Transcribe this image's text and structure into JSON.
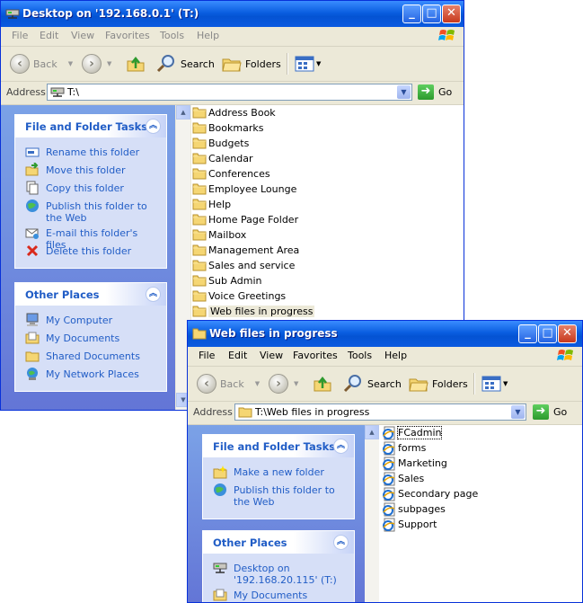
{
  "back_window": {
    "title": "Desktop on '192.168.0.1' (T:)",
    "menu": [
      "File",
      "Edit",
      "View",
      "Favorites",
      "Tools",
      "Help"
    ],
    "toolbar": {
      "back": "Back",
      "search": "Search",
      "folders": "Folders"
    },
    "address": {
      "label": "Address",
      "value": "T:\\",
      "go": "Go"
    },
    "file_tasks": {
      "title": "File and Folder Tasks",
      "items": [
        {
          "label": "Rename this folder",
          "icon": "rename-icon"
        },
        {
          "label": "Move this folder",
          "icon": "move-icon"
        },
        {
          "label": "Copy this folder",
          "icon": "copy-icon"
        },
        {
          "label": "Publish this folder to the Web",
          "icon": "publish-icon"
        },
        {
          "label": "E-mail this folder's files",
          "icon": "email-icon"
        },
        {
          "label": "Delete this folder",
          "icon": "delete-icon"
        }
      ]
    },
    "other_places": {
      "title": "Other Places",
      "items": [
        {
          "label": "My Computer",
          "icon": "computer-icon"
        },
        {
          "label": "My Documents",
          "icon": "documents-icon"
        },
        {
          "label": "Shared Documents",
          "icon": "shared-folder-icon"
        },
        {
          "label": "My Network Places",
          "icon": "network-icon"
        }
      ]
    },
    "folders": [
      "Address Book",
      "Bookmarks",
      "Budgets",
      "Calendar",
      "Conferences",
      "Employee Lounge",
      "Help",
      "Home Page Folder",
      "Mailbox",
      "Management Area",
      "Sales and service",
      "Sub Admin",
      "Voice Greetings",
      "Web files in progress"
    ],
    "selected_folder": "Web files in progress"
  },
  "front_window": {
    "title": "Web files in progress",
    "menu": [
      "File",
      "Edit",
      "View",
      "Favorites",
      "Tools",
      "Help"
    ],
    "toolbar": {
      "back": "Back",
      "search": "Search",
      "folders": "Folders"
    },
    "address": {
      "label": "Address",
      "value": "T:\\Web files in progress",
      "go": "Go"
    },
    "file_tasks": {
      "title": "File and Folder Tasks",
      "items": [
        {
          "label": "Make a new folder",
          "icon": "new-folder-icon"
        },
        {
          "label": "Publish this folder to the Web",
          "icon": "publish-icon"
        }
      ]
    },
    "other_places": {
      "title": "Other Places",
      "items": [
        {
          "label": "Desktop on '192.168.20.115' (T:)",
          "icon": "network-drive-icon"
        },
        {
          "label": "My Documents",
          "icon": "documents-icon"
        }
      ]
    },
    "files": [
      "FCadmin",
      "forms",
      "Marketing",
      "Sales",
      "Secondary page",
      "subpages",
      "Support"
    ],
    "selected_file": "FCadmin"
  }
}
